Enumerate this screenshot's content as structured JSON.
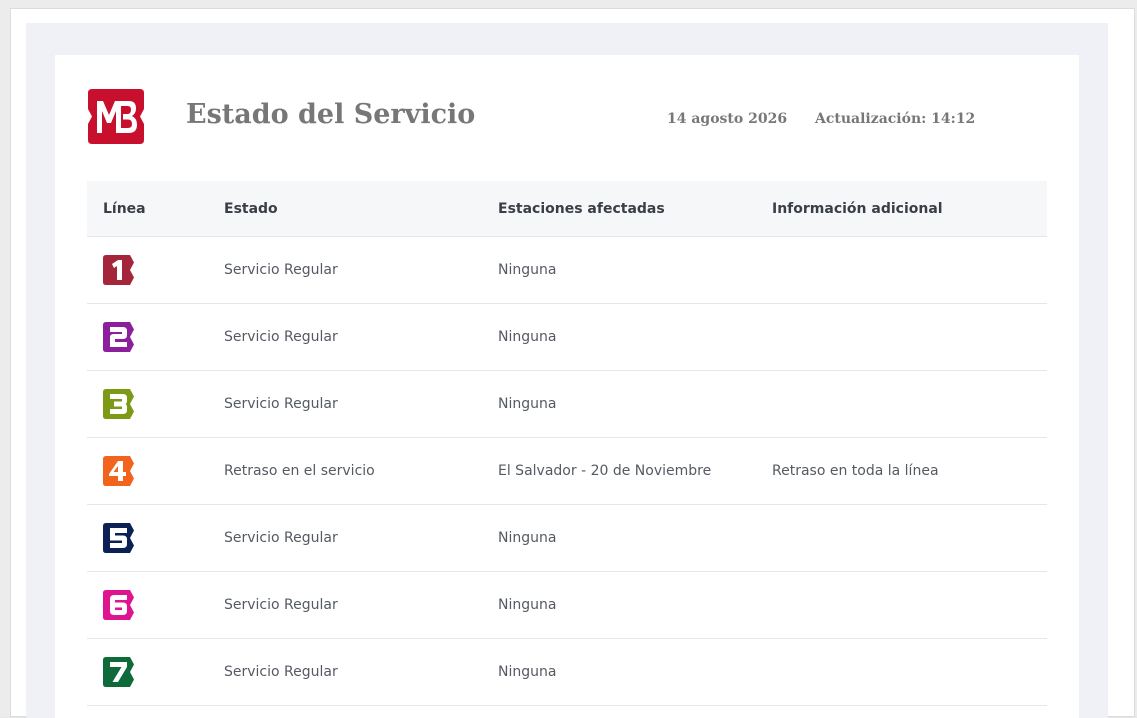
{
  "header": {
    "logo_text": "MB",
    "title": "Estado del Servicio",
    "date": "14 agosto 2026",
    "updated": "Actualización: 14:12"
  },
  "colors": {
    "logo": "#c8102e",
    "line_1": "#a3263a",
    "line_2": "#8b1f9c",
    "line_3": "#7d9a17",
    "line_4": "#f2641d",
    "line_5": "#0b2156",
    "line_6": "#df148f",
    "line_7": "#0f6a3a"
  },
  "table": {
    "headers": {
      "line": "Línea",
      "status": "Estado",
      "stations": "Estaciones afectadas",
      "info": "Información adicional"
    },
    "rows": [
      {
        "line": "1",
        "status": "Servicio Regular",
        "stations": "Ninguna",
        "info": ""
      },
      {
        "line": "2",
        "status": "Servicio Regular",
        "stations": "Ninguna",
        "info": ""
      },
      {
        "line": "3",
        "status": "Servicio Regular",
        "stations": "Ninguna",
        "info": ""
      },
      {
        "line": "4",
        "status": "Retraso en el servicio",
        "stations": "El Salvador - 20 de Noviembre",
        "info": "Retraso en toda la línea"
      },
      {
        "line": "5",
        "status": "Servicio Regular",
        "stations": "Ninguna",
        "info": ""
      },
      {
        "line": "6",
        "status": "Servicio Regular",
        "stations": "Ninguna",
        "info": ""
      },
      {
        "line": "7",
        "status": "Servicio Regular",
        "stations": "Ninguna",
        "info": ""
      }
    ]
  }
}
